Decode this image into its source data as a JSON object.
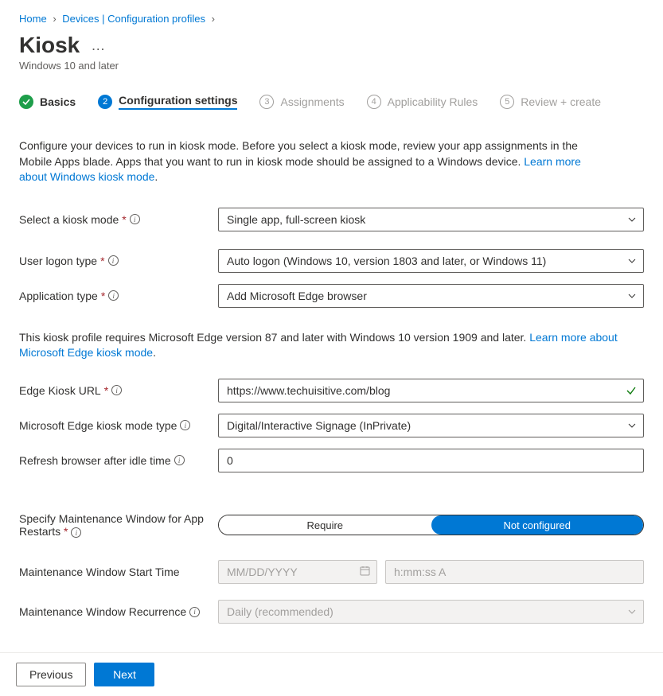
{
  "breadcrumb": {
    "home": "Home",
    "devices": "Devices | Configuration profiles"
  },
  "page": {
    "title": "Kiosk",
    "subtitle": "Windows 10 and later",
    "more_actions": "…"
  },
  "steps": {
    "s1": "Basics",
    "s2": "Configuration settings",
    "s3": "Assignments",
    "s4": "Applicability Rules",
    "s5": "Review + create"
  },
  "intro": {
    "text": "Configure your devices to run in kiosk mode. Before you select a kiosk mode, review your app assignments in the Mobile Apps blade. Apps that you want to run in kiosk mode should be assigned to a Windows device. ",
    "link": "Learn more about Windows kiosk mode",
    "period": "."
  },
  "form": {
    "kiosk_mode_label": "Select a kiosk mode",
    "kiosk_mode_value": "Single app, full-screen kiosk",
    "logon_type_label": "User logon type",
    "logon_type_value": "Auto logon (Windows 10, version 1803 and later, or Windows 11)",
    "app_type_label": "Application type",
    "app_type_value": "Add Microsoft Edge browser",
    "edge_url_label": "Edge Kiosk URL",
    "edge_url_value": "https://www.techuisitive.com/blog",
    "edge_mode_label": "Microsoft Edge kiosk mode type",
    "edge_mode_value": "Digital/Interactive Signage (InPrivate)",
    "refresh_label": "Refresh browser after idle time",
    "refresh_value": "0",
    "maint_window_label": "Specify Maintenance Window for App Restarts",
    "toggle_require": "Require",
    "toggle_notconfigured": "Not configured",
    "maint_start_label": "Maintenance Window Start Time",
    "maint_start_date_placeholder": "MM/DD/YYYY",
    "maint_start_time_placeholder": "h:mm:ss A",
    "maint_recurrence_label": "Maintenance Window Recurrence",
    "maint_recurrence_value": "Daily (recommended)"
  },
  "note": {
    "text": "This kiosk profile requires Microsoft Edge version 87 and later with Windows 10 version 1909 and later. ",
    "link": "Learn more about Microsoft Edge kiosk mode",
    "period": "."
  },
  "footer": {
    "previous": "Previous",
    "next": "Next"
  },
  "badges": {
    "n2": "2",
    "n3": "3",
    "n4": "4",
    "n5": "5"
  }
}
